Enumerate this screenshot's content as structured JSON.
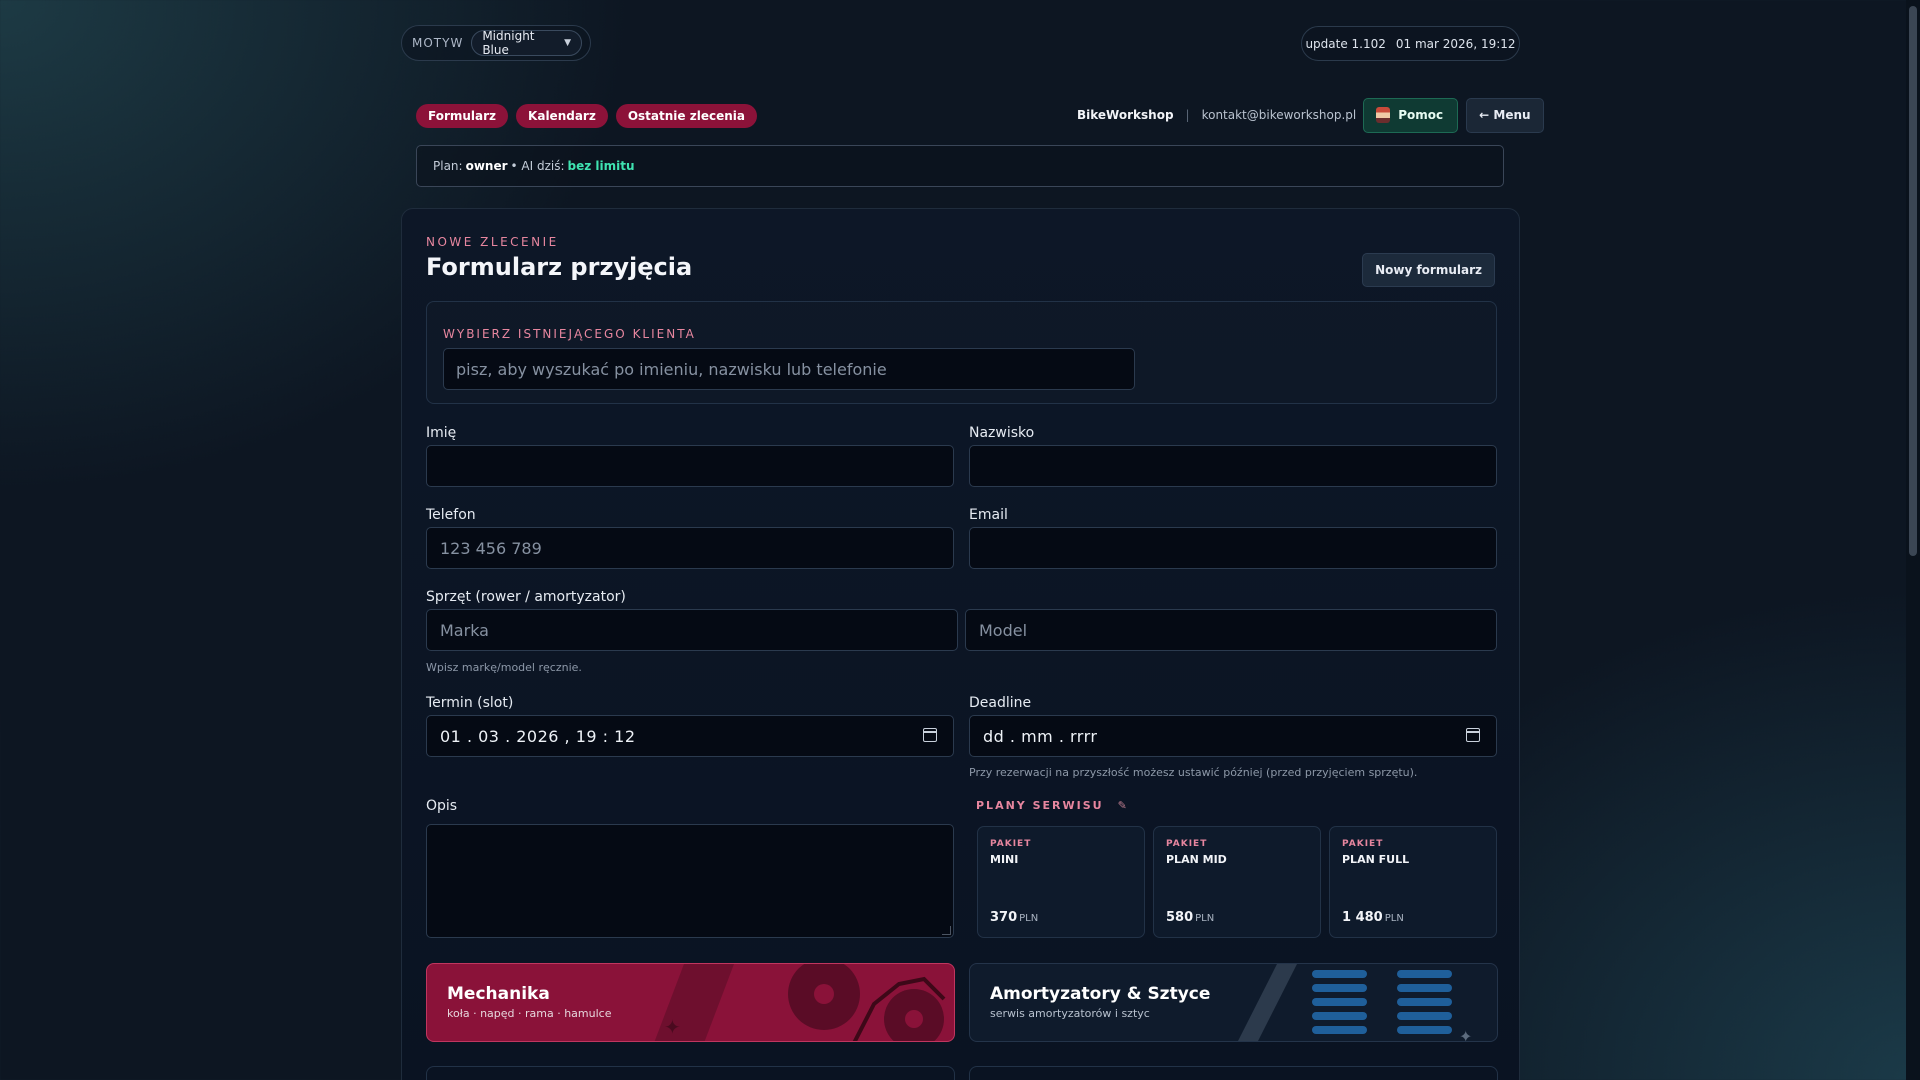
{
  "theme": {
    "label": "MOTYW",
    "selected": "Midnight Blue"
  },
  "update": {
    "version": "update 1.102",
    "datetime": "01 mar 2026, 19:12"
  },
  "nav": {
    "tabs": [
      "Formularz",
      "Kalendarz",
      "Ostatnie zlecenia"
    ]
  },
  "header": {
    "brand": "BikeWorkshop",
    "separator": "|",
    "contact": "kontakt@bikeworkshop.pl",
    "help_label": "Pomoc",
    "menu_label": "← Menu"
  },
  "plan_bar": {
    "plan_prefix": "Plan:",
    "plan_value": "owner",
    "ai_prefix": "• AI dziś:",
    "ai_value": "bez limitu"
  },
  "form": {
    "eyebrow": "NOWE ZLECENIE",
    "title": "Formularz przyjęcia",
    "new_form_button": "Nowy formularz",
    "client_search": {
      "label": "WYBIERZ ISTNIEJĄCEGO KLIENTA",
      "placeholder": "pisz, aby wyszukać po imieniu, nazwisku lub telefonie"
    },
    "first_name": {
      "label": "Imię",
      "value": ""
    },
    "last_name": {
      "label": "Nazwisko",
      "value": ""
    },
    "phone": {
      "label": "Telefon",
      "placeholder": "123 456 789"
    },
    "email": {
      "label": "Email",
      "value": ""
    },
    "equipment": {
      "label": "Sprzęt (rower / amortyzator)",
      "brand_placeholder": "Marka",
      "model_placeholder": "Model",
      "hint": "Wpisz markę/model ręcznie."
    },
    "slot": {
      "label": "Termin (slot)",
      "value": "01 . 03 . 2026 ,  19 : 12"
    },
    "deadline": {
      "label": "Deadline",
      "placeholder": "dd . mm . rrrr",
      "hint": "Przy rezerwacji na przyszłość możesz ustawić później (przed przyjęciem sprzętu)."
    },
    "description": {
      "label": "Opis",
      "value": ""
    }
  },
  "service_plans": {
    "title": "PLANY SERWISU",
    "edit_icon": "pencil-icon",
    "items": [
      {
        "tag": "PAKIET",
        "name": "MINI",
        "price": "370",
        "currency": "PLN"
      },
      {
        "tag": "PAKIET",
        "name": "PLAN MID",
        "price": "580",
        "currency": "PLN"
      },
      {
        "tag": "PAKIET",
        "name": "PLAN FULL",
        "price": "1 480",
        "currency": "PLN"
      }
    ]
  },
  "categories": [
    {
      "title": "Mechanika",
      "subtitle": "koła · napęd · rama · hamulce",
      "accent": "#8a1239"
    },
    {
      "title": "Amortyzatory & Sztyce",
      "subtitle": "serwis amortyzatorów i sztyc",
      "accent": "#0f1b2c"
    }
  ],
  "colors": {
    "accent": "#8c1239",
    "success": "#3fe3b1",
    "label_pink": "#e7869f",
    "background": "#0d1622"
  }
}
